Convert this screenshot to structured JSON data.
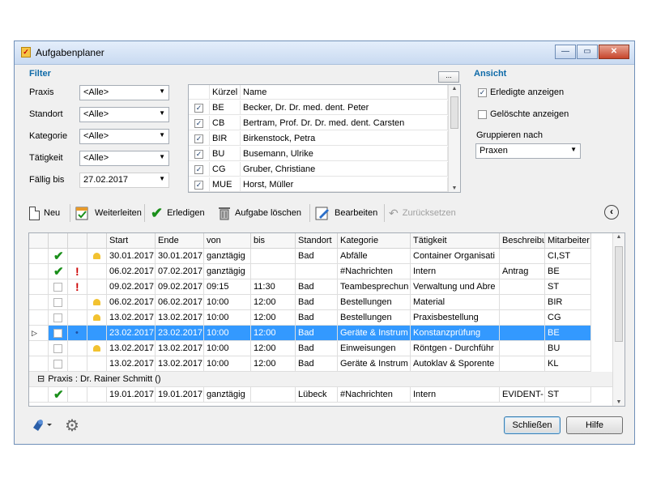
{
  "window": {
    "title": "Aufgabenplaner",
    "min_label": "—",
    "max_label": "▭",
    "close_label": "✕"
  },
  "filter": {
    "title": "Filter",
    "fields": [
      {
        "label": "Praxis",
        "value": "<Alle>"
      },
      {
        "label": "Standort",
        "value": "<Alle>"
      },
      {
        "label": "Kategorie",
        "value": "<Alle>"
      },
      {
        "label": "Tätigkeit",
        "value": "<Alle>"
      },
      {
        "label": "Fällig bis",
        "value": "27.02.2017"
      }
    ],
    "dots_label": "..."
  },
  "personnel": {
    "headers": {
      "kuerzel": "Kürzel",
      "name": "Name"
    },
    "rows": [
      {
        "checked": true,
        "kuerzel": "BE",
        "name": "Becker, Dr. Dr. med. dent. Peter"
      },
      {
        "checked": true,
        "kuerzel": "CB",
        "name": "Bertram, Prof. Dr. Dr. med. dent. Carsten"
      },
      {
        "checked": true,
        "kuerzel": "BIR",
        "name": "Birkenstock, Petra"
      },
      {
        "checked": true,
        "kuerzel": "BU",
        "name": "Busemann, Ulrike"
      },
      {
        "checked": true,
        "kuerzel": "CG",
        "name": "Gruber, Christiane"
      },
      {
        "checked": true,
        "kuerzel": "MUE",
        "name": "Horst, Müller"
      }
    ]
  },
  "ansicht": {
    "title": "Ansicht",
    "erledigte": {
      "label": "Erledigte anzeigen",
      "checked": true
    },
    "geloeschte": {
      "label": "Gelöschte anzeigen",
      "checked": false
    },
    "gruppieren_label": "Gruppieren nach",
    "gruppieren_value": "Praxen"
  },
  "toolbar": {
    "neu": "Neu",
    "weiterleiten": "Weiterleiten",
    "erledigen": "Erledigen",
    "loeschen": "Aufgabe löschen",
    "bearbeiten": "Bearbeiten",
    "zuruecksetzen": "Zurücksetzen"
  },
  "grid": {
    "headers": [
      "Start",
      "Ende",
      "von",
      "bis",
      "Standort",
      "Kategorie",
      "Tätigkeit",
      "Beschreibu",
      "Mitarbeiter"
    ],
    "rows": [
      {
        "status": "check",
        "flag": "",
        "bell": true,
        "start": "30.01.2017",
        "ende": "30.01.2017",
        "von": "ganztägig",
        "bis": "",
        "standort": "Bad",
        "kategorie": "Abfälle",
        "taetigkeit": "Container Organisati",
        "beschreibung": "",
        "mitarbeiter": "CI,ST"
      },
      {
        "status": "check",
        "flag": "!",
        "bell": false,
        "start": "06.02.2017",
        "ende": "07.02.2017",
        "von": "ganztägig",
        "bis": "",
        "standort": "",
        "kategorie": "#Nachrichten",
        "taetigkeit": "Intern",
        "beschreibung": "Antrag",
        "mitarbeiter": "BE"
      },
      {
        "status": "box",
        "flag": "!",
        "bell": false,
        "start": "09.02.2017",
        "ende": "09.02.2017",
        "von": "09:15",
        "bis": "11:30",
        "standort": "Bad",
        "kategorie": "Teambesprechun",
        "taetigkeit": "Verwaltung und Abre",
        "beschreibung": "",
        "mitarbeiter": "ST"
      },
      {
        "status": "box",
        "flag": "",
        "bell": true,
        "start": "06.02.2017",
        "ende": "06.02.2017",
        "von": "10:00",
        "bis": "12:00",
        "standort": "Bad",
        "kategorie": "Bestellungen",
        "taetigkeit": "Material",
        "beschreibung": "",
        "mitarbeiter": "BIR"
      },
      {
        "status": "box",
        "flag": "",
        "bell": true,
        "start": "13.02.2017",
        "ende": "13.02.2017",
        "von": "10:00",
        "bis": "12:00",
        "standort": "Bad",
        "kategorie": "Bestellungen",
        "taetigkeit": "Praxisbestellung",
        "beschreibung": "",
        "mitarbeiter": "CG"
      },
      {
        "status": "box",
        "flag": ".",
        "bell": false,
        "selected": true,
        "start": "23.02.2017",
        "ende": "23.02.2017",
        "von": "10:00",
        "bis": "12:00",
        "standort": "Bad",
        "kategorie": "Geräte & Instrum",
        "taetigkeit": "Konstanzprüfung",
        "beschreibung": "",
        "mitarbeiter": "BE"
      },
      {
        "status": "box",
        "flag": "",
        "bell": true,
        "start": "13.02.2017",
        "ende": "13.02.2017",
        "von": "10:00",
        "bis": "12:00",
        "standort": "Bad",
        "kategorie": "Einweisungen",
        "taetigkeit": "Röntgen - Durchführ",
        "beschreibung": "",
        "mitarbeiter": "BU"
      },
      {
        "status": "box",
        "flag": "",
        "bell": false,
        "start": "13.02.2017",
        "ende": "13.02.2017",
        "von": "10:00",
        "bis": "12:00",
        "standort": "Bad",
        "kategorie": "Geräte & Instrum",
        "taetigkeit": "Autoklav & Sporente",
        "beschreibung": "",
        "mitarbeiter": "KL"
      }
    ],
    "group_label": "Praxis : Dr. Rainer Schmitt ()",
    "group_rows": [
      {
        "status": "check",
        "flag": "",
        "bell": false,
        "start": "19.01.2017",
        "ende": "19.01.2017",
        "von": "ganztägig",
        "bis": "",
        "standort": "Lübeck",
        "kategorie": "#Nachrichten",
        "taetigkeit": "Intern",
        "beschreibung": "EVIDENT-",
        "mitarbeiter": "ST"
      }
    ]
  },
  "footer": {
    "close": "Schließen",
    "help": "Hilfe"
  }
}
